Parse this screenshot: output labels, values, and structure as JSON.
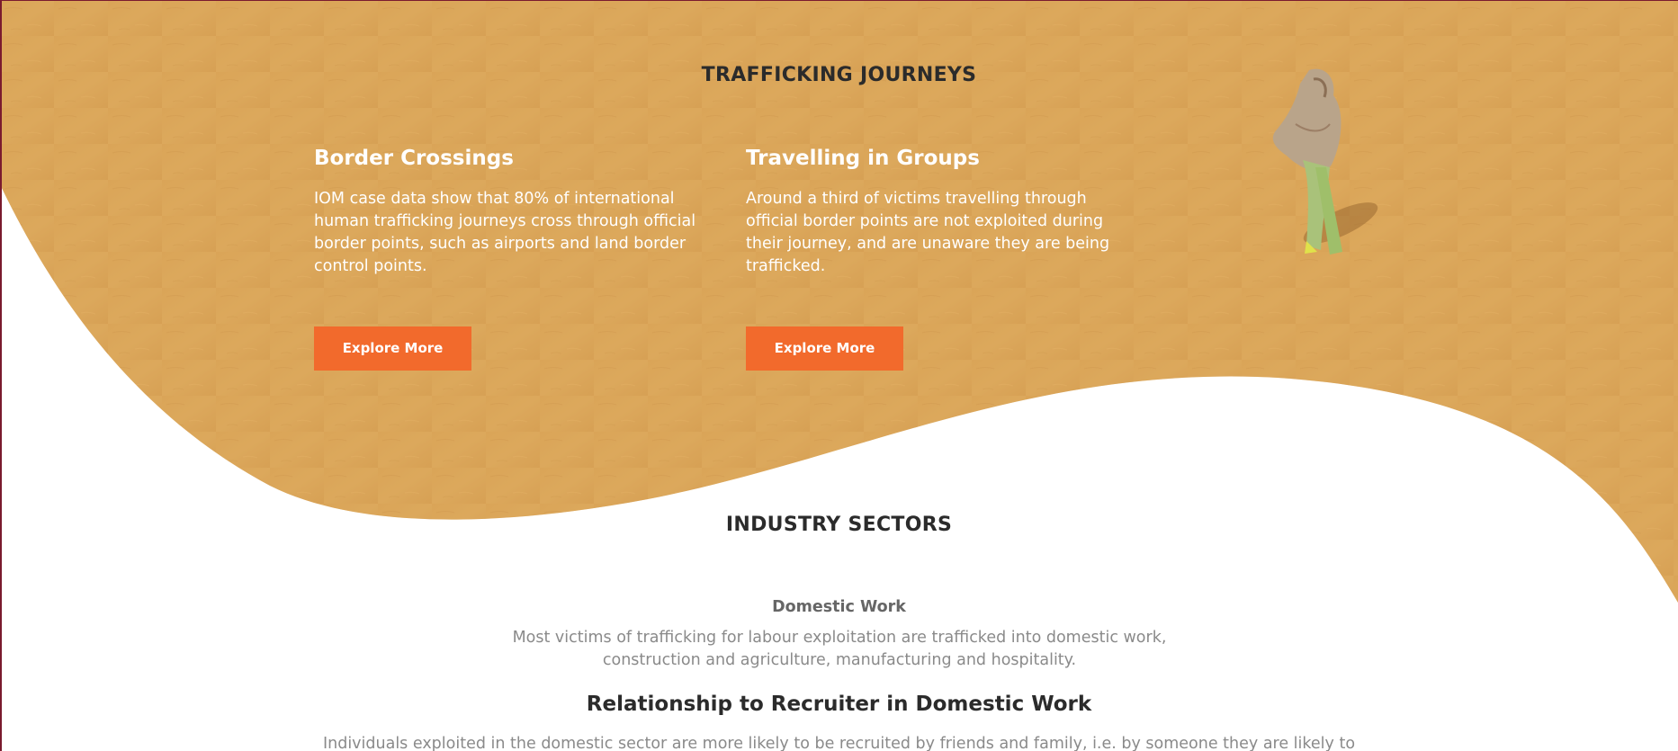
{
  "colors": {
    "sand": "#dca75a",
    "sand_dark": "#c8924a",
    "accent_button": "#f26a2c",
    "heading": "#2b2b2b",
    "muted_text": "#8a8a8a",
    "edge": "#7a1a2e"
  },
  "journeys": {
    "title": "TRAFFICKING JOURNEYS",
    "cards": [
      {
        "heading": "Border Crossings",
        "body": "IOM case data show that 80% of international human trafficking journeys cross through official border points, such as airports and land border control points.",
        "button_label": "Explore More"
      },
      {
        "heading": "Travelling in Groups",
        "body": "Around a third of victims travelling through official border points are not exploited during their journey, and are unaware they are being trafficked.",
        "button_label": "Explore More"
      }
    ]
  },
  "industry": {
    "title": "INDUSTRY SECTORS",
    "sector_name": "Domestic Work",
    "sector_desc": "Most victims of trafficking for labour exploitation are trafficked into domestic work, construction and agriculture, manufacturing and hospitality.",
    "sub_heading": "Relationship to Recruiter in Domestic Work",
    "trailing_text": "Individuals exploited in the domestic sector are more likely to be recruited by friends and family, i.e. by someone they are likely to"
  }
}
